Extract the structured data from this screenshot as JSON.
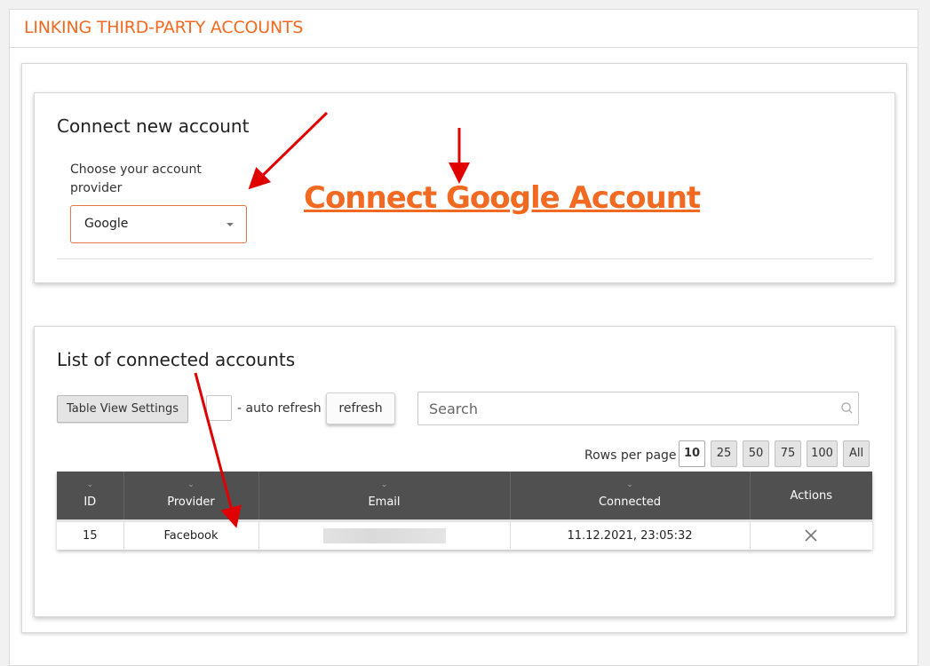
{
  "page": {
    "title": "LINKING THIRD-PARTY ACCOUNTS"
  },
  "connect": {
    "title": "Connect new account",
    "provider_label": "Choose your account provider",
    "provider_value": "Google",
    "link_text": "Connect Google Account"
  },
  "list": {
    "title": "List of connected accounts",
    "table_settings_label": "Table View Settings",
    "auto_refresh_label": "- auto refresh",
    "refresh_label": "refresh",
    "search_placeholder": "Search",
    "rows_per_page_label": "Rows per page",
    "page_sizes": [
      "10",
      "25",
      "50",
      "75",
      "100",
      "All"
    ],
    "selected_page_size": "10",
    "columns": [
      "ID",
      "Provider",
      "Email",
      "Connected",
      "Actions"
    ],
    "rows": [
      {
        "id": "15",
        "provider": "Facebook",
        "email": "",
        "connected": "11.12.2021, 23:05:32"
      }
    ]
  },
  "colors": {
    "accent": "#f26a21",
    "header_bg": "#505050",
    "annotation": "#e00000"
  },
  "icons": {
    "search": "search-icon",
    "remove": "close-icon",
    "dropdown": "chevron-down-icon"
  }
}
